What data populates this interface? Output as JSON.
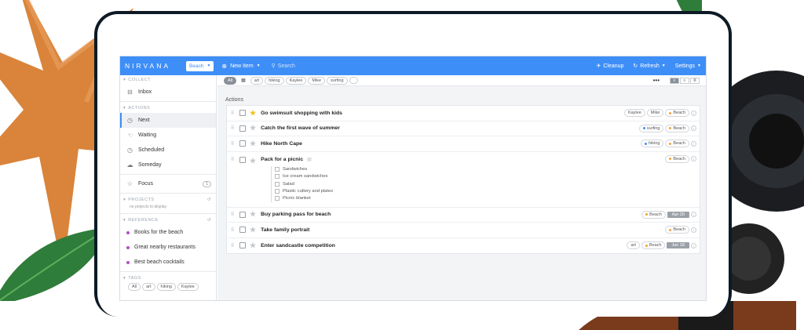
{
  "app": {
    "logo": "NIRVANA",
    "focus_selector": "Beach",
    "new_item": "New Item",
    "search_placeholder": "Search",
    "cleanup": "Cleanup",
    "refresh": "Refresh",
    "settings": "Settings"
  },
  "sidebar": {
    "collect_header": "COLLECT",
    "inbox": "Inbox",
    "actions_header": "ACTIONS",
    "next": "Next",
    "waiting": "Waiting",
    "scheduled": "Scheduled",
    "someday": "Someday",
    "focus": "Focus",
    "focus_count": "1",
    "projects_header": "PROJECTS",
    "projects_empty": "no projects to display",
    "reference_header": "REFERENCE",
    "reference_items": [
      "Books for the beach",
      "Great nearby restaurants",
      "Best beach cocktails"
    ],
    "tags_header": "TAGS",
    "tags": [
      "All",
      "art",
      "hiking",
      "Kaylee"
    ]
  },
  "filterbar": {
    "all": "All",
    "tags": [
      "art",
      "hiking",
      "Kaylee",
      "Mike",
      "surfing"
    ],
    "more": "•••"
  },
  "main": {
    "list_title": "Actions",
    "tasks": [
      {
        "title": "Go swimsuit shopping with kids",
        "starred": true,
        "tags": [
          "Kaylee",
          "Mike"
        ],
        "area": "Beach"
      },
      {
        "title": "Catch the first wave of summer",
        "starred": false,
        "tags": [
          "surfing"
        ],
        "area": "Beach"
      },
      {
        "title": "Hike North Cape",
        "starred": false,
        "tags": [
          "hiking"
        ],
        "area": "Beach"
      },
      {
        "title": "Pack for a picnic",
        "starred": false,
        "tags": [],
        "area": "Beach",
        "checklist": [
          "Sandwiches",
          "Ice cream sandwiches",
          "Salad",
          "Plastic cutlery and plates",
          "Picnic blanket"
        ]
      },
      {
        "title": "Buy parking pass for beach",
        "starred": false,
        "tags": [],
        "area": "Beach",
        "due": "Apr 20"
      },
      {
        "title": "Take family portrait",
        "starred": false,
        "tags": [],
        "area": "Beach"
      },
      {
        "title": "Enter sandcastle competition",
        "starred": false,
        "tags": [
          "art"
        ],
        "area": "Beach",
        "due": "Jun 16"
      }
    ]
  },
  "colors": {
    "accent": "#3e8ef7",
    "area_dot": "#f0a33a",
    "tag_dot": "#3e8ef7",
    "star": "#f3c11b"
  }
}
